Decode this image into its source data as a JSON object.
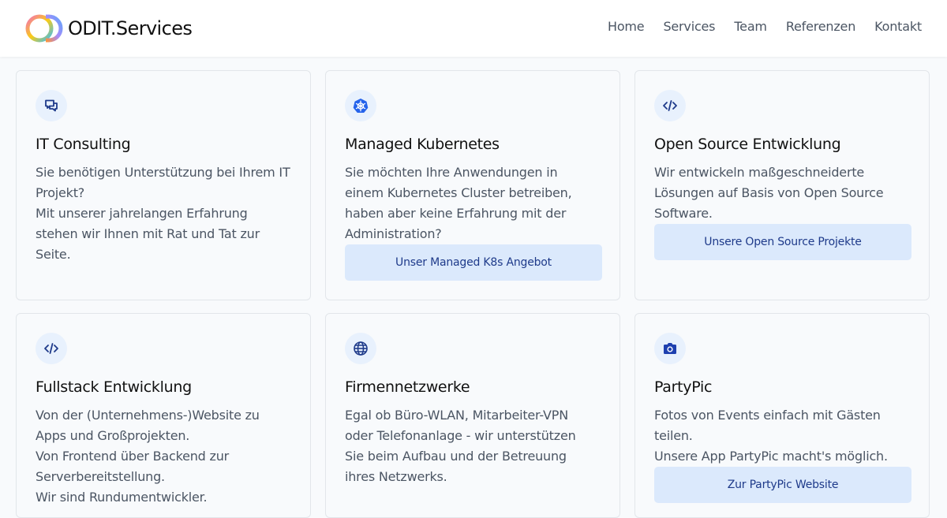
{
  "header": {
    "brand": "ODIT.Services",
    "nav": [
      {
        "label": "Home"
      },
      {
        "label": "Services"
      },
      {
        "label": "Team"
      },
      {
        "label": "Referenzen"
      },
      {
        "label": "Kontakt"
      }
    ]
  },
  "cards": [
    {
      "icon": "chat-bubbles-icon",
      "title": "IT Consulting",
      "lines": [
        "Sie benötigen Unterstützung bei Ihrem IT",
        "Projekt?",
        "Mit unserer jahrelangen Erfahrung",
        "stehen wir Ihnen mit Rat und Tat zur",
        "Seite."
      ]
    },
    {
      "icon": "kubernetes-icon",
      "title": "Managed Kubernetes",
      "lines": [
        "Sie möchten Ihre Anwendungen in",
        "einem Kubernetes Cluster betreiben,",
        "haben aber keine Erfahrung mit der",
        "Administration?"
      ],
      "button": "Unser Managed K8s Angebot"
    },
    {
      "icon": "code-icon",
      "title": "Open Source Entwicklung",
      "lines": [
        "Wir entwickeln maßgeschneiderte",
        "Lösungen auf Basis von Open Source",
        "Software."
      ],
      "button": "Unsere Open Source Projekte"
    },
    {
      "icon": "code-icon",
      "title": "Fullstack Entwicklung",
      "lines": [
        "Von der (Unternehmens-)Website zu",
        "Apps und Großprojekten.",
        "Von Frontend über Backend zur",
        "Serverbereitstellung.",
        "Wir sind Rundumentwickler."
      ]
    },
    {
      "icon": "globe-icon",
      "title": "Firmennetzwerke",
      "lines": [
        "Egal ob Büro-WLAN, Mitarbeiter-VPN",
        "oder Telefonanlage - wir unterstützen",
        "Sie beim Aufbau und der Betreuung",
        "ihres Netzwerks."
      ]
    },
    {
      "icon": "camera-icon",
      "title": "PartyPic",
      "lines": [
        "Fotos von Events einfach mit Gästen",
        "teilen.",
        "Unsere App PartyPic macht's möglich."
      ],
      "button": "Zur PartyPic Website"
    }
  ],
  "colors": {
    "accent": "#1d4ed8",
    "button_bg": "#dbe9fc",
    "icon_bg": "#e8f1fd",
    "page_bg": "#f8fafc"
  }
}
